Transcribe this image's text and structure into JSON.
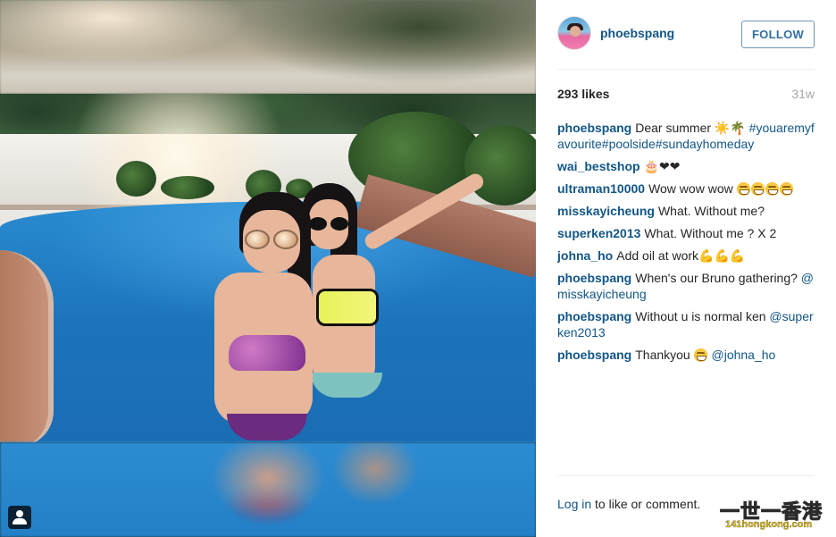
{
  "post": {
    "owner": {
      "username": "phoebspang",
      "avatar_icon": "profile-photo"
    },
    "follow_button_label": "FOLLOW",
    "likes": "293 likes",
    "age": "31w",
    "photo_overlay_icon": "user-tag-icon",
    "comments": [
      {
        "author": "phoebspang",
        "text_parts": [
          "Dear summer ☀️🌴",
          "#youaremyfavourite#poolside#sundayhomeday"
        ]
      },
      {
        "author": "wai_bestshop",
        "text": "🎂❤❤"
      },
      {
        "author": "ultraman10000",
        "text": "Wow wow wow"
      },
      {
        "author": "misskayicheung",
        "text": "What. Without me?"
      },
      {
        "author": "superken2013",
        "text": "What. Without me ? X 2"
      },
      {
        "author": "johna_ho",
        "text": "Add oil at work💪💪💪"
      },
      {
        "author": "phoebspang",
        "text": "When's our Bruno gathering?",
        "mention": "@misskayicheung"
      },
      {
        "author": "phoebspang",
        "text": "Without u is normal ken",
        "mention": "@superken2013"
      },
      {
        "author": "phoebspang",
        "text": "Thankyou",
        "mention": "@johna_ho"
      }
    ],
    "login_prompt": {
      "link": "Log in",
      "rest": " to like or comment."
    }
  },
  "watermark": {
    "top": "一世一香港",
    "bottom": "141hongkong.com"
  },
  "colors": {
    "link_blue": "#125688",
    "follow_border": "#6f97b6",
    "muted": "#a5a7aa",
    "divider": "#efefef"
  }
}
